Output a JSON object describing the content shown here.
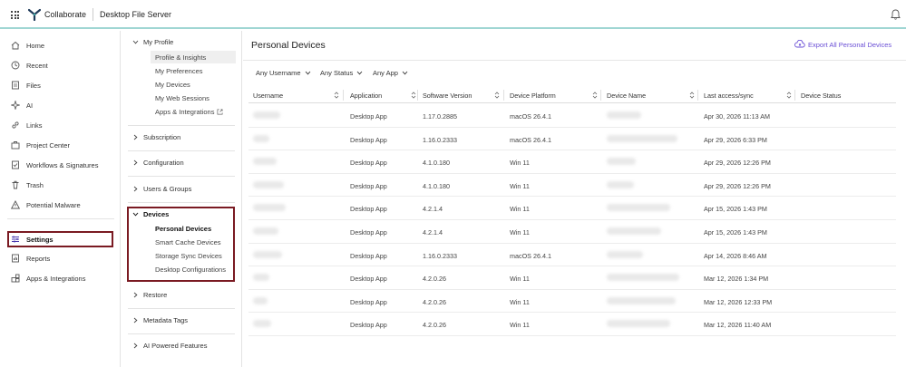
{
  "topbar": {
    "brand": "Collaborate",
    "app_title": "Desktop File Server",
    "icons": [
      "apps-grid-icon",
      "collaborate-logo-icon",
      "bell-icon"
    ]
  },
  "sidebar": {
    "items": [
      {
        "label": "Home",
        "icon": "home-icon"
      },
      {
        "label": "Recent",
        "icon": "clock-icon"
      },
      {
        "label": "Files",
        "icon": "files-icon"
      },
      {
        "label": "AI",
        "icon": "ai-sparkle-icon"
      },
      {
        "label": "Links",
        "icon": "link-icon"
      },
      {
        "label": "Project Center",
        "icon": "briefcase-icon"
      },
      {
        "label": "Workflows & Signatures",
        "icon": "workflow-icon"
      },
      {
        "label": "Trash",
        "icon": "trash-icon"
      },
      {
        "label": "Potential Malware",
        "icon": "warning-icon"
      },
      {
        "label": "Settings",
        "icon": "sliders-icon"
      },
      {
        "label": "Reports",
        "icon": "reports-icon"
      },
      {
        "label": "Apps & Integrations",
        "icon": "apps-icon"
      }
    ]
  },
  "subnav": {
    "my_profile": {
      "label": "My Profile",
      "items": [
        "Profile & Insights",
        "My Preferences",
        "My Devices",
        "My Web Sessions",
        "Apps & Integrations"
      ]
    },
    "subscription": "Subscription",
    "configuration": "Configuration",
    "users_groups": "Users & Groups",
    "devices": {
      "label": "Devices",
      "items": [
        "Personal Devices",
        "Smart Cache Devices",
        "Storage Sync Devices",
        "Desktop Configurations"
      ]
    },
    "restore": "Restore",
    "metadata_tags": "Metadata Tags",
    "ai_features": "AI Powered Features"
  },
  "main": {
    "title": "Personal Devices",
    "export_label": "Export All Personal Devices",
    "filters": [
      "Any Username",
      "Any Status",
      "Any App"
    ],
    "columns": [
      "Username",
      "Application",
      "Software Version",
      "Device Platform",
      "Device Name",
      "Last access/sync",
      "Device Status"
    ],
    "rows": [
      {
        "application": "Desktop App",
        "version": "1.17.0.2885",
        "platform": "macOS 26.4.1",
        "last_access": "Apr 30, 2026 11:13 AM"
      },
      {
        "application": "Desktop App",
        "version": "1.16.0.2333",
        "platform": "macOS 26.4.1",
        "last_access": "Apr 29, 2026 6:33 PM"
      },
      {
        "application": "Desktop App",
        "version": "4.1.0.180",
        "platform": "Win 11",
        "last_access": "Apr 29, 2026 12:26 PM"
      },
      {
        "application": "Desktop App",
        "version": "4.1.0.180",
        "platform": "Win 11",
        "last_access": "Apr 29, 2026 12:26 PM"
      },
      {
        "application": "Desktop App",
        "version": "4.2.1.4",
        "platform": "Win 11",
        "last_access": "Apr 15, 2026 1:43 PM"
      },
      {
        "application": "Desktop App",
        "version": "4.2.1.4",
        "platform": "Win 11",
        "last_access": "Apr 15, 2026 1:43 PM"
      },
      {
        "application": "Desktop App",
        "version": "1.16.0.2333",
        "platform": "macOS 26.4.1",
        "last_access": "Apr 14, 2026 8:46 AM"
      },
      {
        "application": "Desktop App",
        "version": "4.2.0.26",
        "platform": "Win 11",
        "last_access": "Mar 12, 2026 1:34 PM"
      },
      {
        "application": "Desktop App",
        "version": "4.2.0.26",
        "platform": "Win 11",
        "last_access": "Mar 12, 2026 12:33 PM"
      },
      {
        "application": "Desktop App",
        "version": "4.2.0.26",
        "platform": "Win 11",
        "last_access": "Mar 12, 2026 11:40 AM"
      }
    ]
  },
  "colors": {
    "highlight_border": "#7a1a22",
    "accent": "#6a4fd6",
    "topbar_border": "#9fd6d3"
  }
}
